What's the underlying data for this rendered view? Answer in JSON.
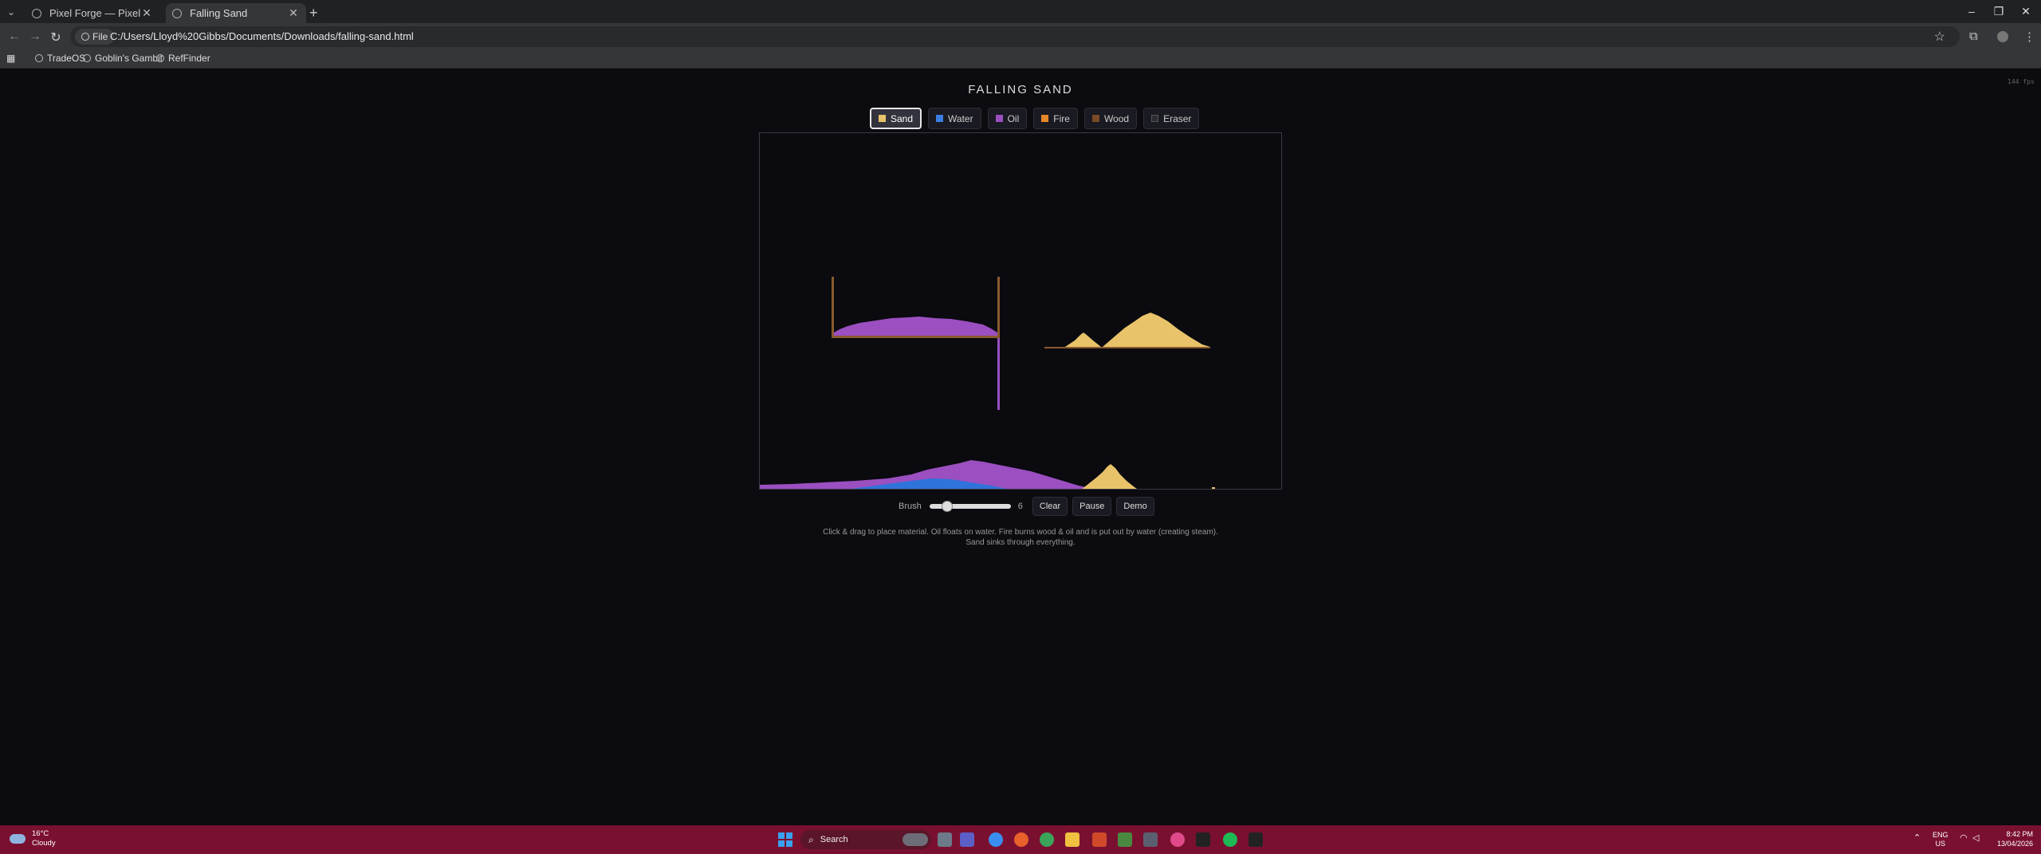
{
  "browser": {
    "tabs": [
      {
        "title": "Pixel Forge — Pixel Art Editor",
        "active": false
      },
      {
        "title": "Falling Sand",
        "active": true
      }
    ],
    "file_chip": "File",
    "url": "C:/Users/Lloyd%20Gibbs/Documents/Downloads/falling-sand.html",
    "bookmarks": [
      "TradeOS",
      "Goblin's Gambit",
      "RefFinder"
    ]
  },
  "page": {
    "title": "FALLING SAND",
    "fps": "144 fps",
    "materials": [
      {
        "label": "Sand",
        "color": "#e8c36a",
        "active": true
      },
      {
        "label": "Water",
        "color": "#3a7ee0",
        "active": false
      },
      {
        "label": "Oil",
        "color": "#9b4fc0",
        "active": false
      },
      {
        "label": "Fire",
        "color": "#e8862a",
        "active": false
      },
      {
        "label": "Wood",
        "color": "#7a4a25",
        "active": false
      },
      {
        "label": "Eraser",
        "color": "#2a2a30",
        "active": false
      }
    ],
    "controls": {
      "brush_label": "Brush",
      "brush_value": "6",
      "brush_fraction": 0.15,
      "clear": "Clear",
      "pause": "Pause",
      "demo": "Demo"
    },
    "help_line1": "Click & drag to place material. Oil floats on water. Fire burns wood & oil and is put out by water (creating steam).",
    "help_line2": "Sand sinks through everything."
  },
  "taskbar": {
    "temp": "16°C",
    "condition": "Cloudy",
    "search": "Search",
    "lang": "ENG",
    "region": "US",
    "time": "8:42 PM",
    "date": "13/04/2026"
  }
}
